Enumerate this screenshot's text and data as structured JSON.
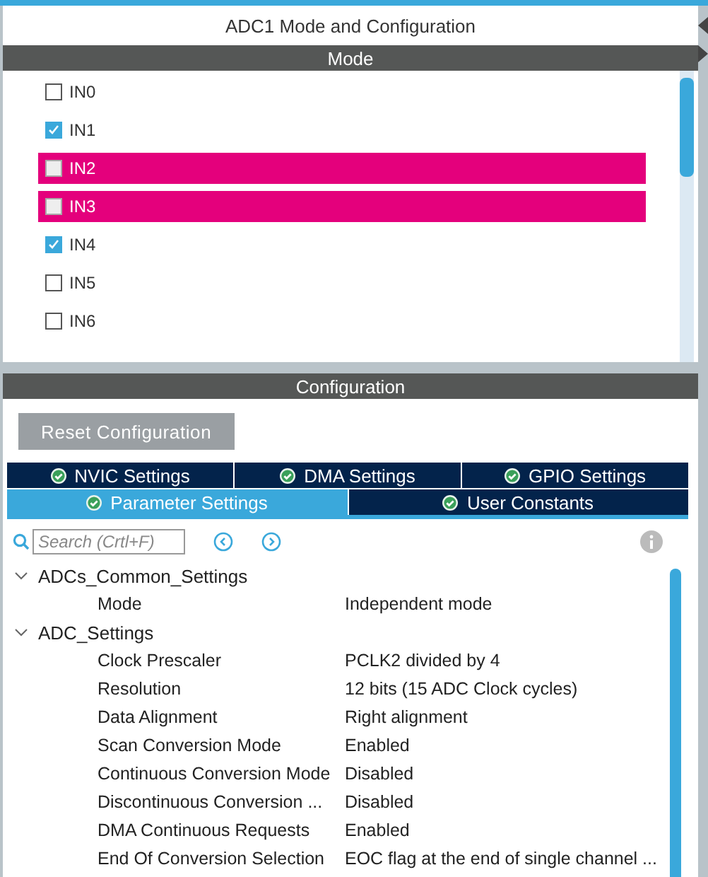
{
  "panel_title": "ADC1 Mode and Configuration",
  "mode": {
    "header": "Mode",
    "channels": [
      {
        "label": "IN0",
        "checked": false,
        "conflict": false
      },
      {
        "label": "IN1",
        "checked": true,
        "conflict": false
      },
      {
        "label": "IN2",
        "checked": false,
        "conflict": true
      },
      {
        "label": "IN3",
        "checked": false,
        "conflict": true
      },
      {
        "label": "IN4",
        "checked": true,
        "conflict": false
      },
      {
        "label": "IN5",
        "checked": false,
        "conflict": false
      },
      {
        "label": "IN6",
        "checked": false,
        "conflict": false
      }
    ]
  },
  "configuration": {
    "header": "Configuration",
    "reset_button": "Reset Configuration",
    "tab_rows": [
      [
        {
          "label": "NVIC Settings",
          "selected": false
        },
        {
          "label": "DMA Settings",
          "selected": false
        },
        {
          "label": "GPIO Settings",
          "selected": false
        }
      ],
      [
        {
          "label": "Parameter Settings",
          "selected": true
        },
        {
          "label": "User Constants",
          "selected": false
        }
      ]
    ],
    "search": {
      "placeholder": "Search (Crtl+F)"
    },
    "tree": [
      {
        "name": "ADCs_Common_Settings",
        "expanded": true,
        "children": [
          {
            "name": "Mode",
            "value": "Independent mode"
          }
        ]
      },
      {
        "name": "ADC_Settings",
        "expanded": true,
        "children": [
          {
            "name": "Clock Prescaler",
            "value": "PCLK2 divided by 4"
          },
          {
            "name": "Resolution",
            "value": "12 bits (15 ADC Clock cycles)"
          },
          {
            "name": "Data Alignment",
            "value": "Right alignment"
          },
          {
            "name": "Scan Conversion Mode",
            "value": "Enabled"
          },
          {
            "name": "Continuous Conversion Mode",
            "value": "Disabled"
          },
          {
            "name": "Discontinuous Conversion ...",
            "value": "Disabled"
          },
          {
            "name": "DMA Continuous Requests",
            "value": "Enabled"
          },
          {
            "name": "End Of Conversion Selection",
            "value": "EOC flag at the end of single channel ..."
          }
        ]
      }
    ]
  }
}
